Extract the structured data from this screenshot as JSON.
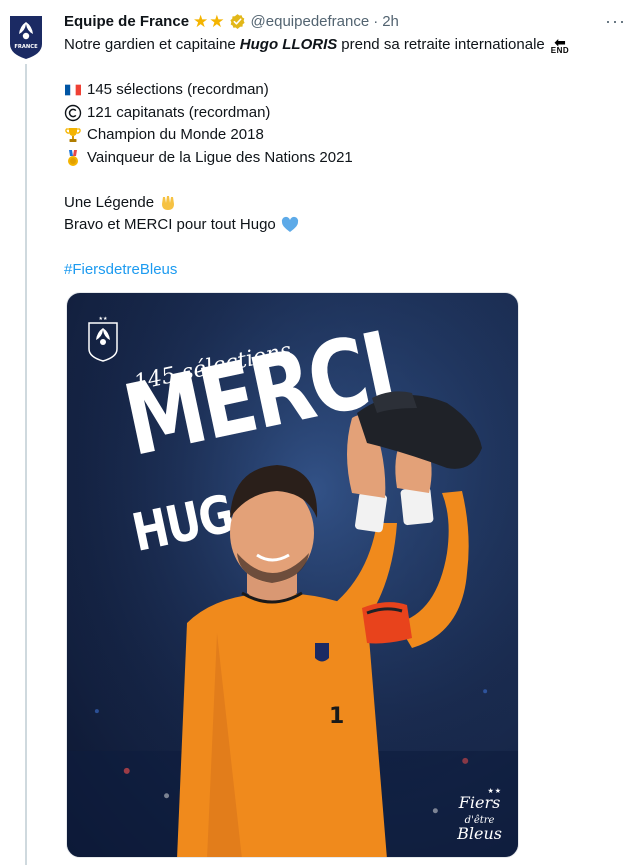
{
  "tweet": {
    "author_name": "Equipe de France",
    "handle": "@equipedefrance",
    "separator": "·",
    "time": "2h",
    "more_label": "···",
    "text_line1_before": "Notre gardien et capitaine",
    "text_line1_emph": "Hugo LLORIS",
    "text_line1_after": "prend sa retraite internationale",
    "end_label": "END",
    "stat_lines": [
      "145 sélections (recordman)",
      "121 capitanats (recordman)",
      "Champion du Monde 2018",
      "Vainqueur de la Ligue des Nations 2021"
    ],
    "legend_line": "Une Légende",
    "bravo_line": "Bravo et MERCI pour tout Hugo",
    "hashtag": "#FiersdetreBleus"
  },
  "avatar": {
    "label": "FRANCE"
  },
  "media": {
    "selections_text": "145 sélections",
    "big_title": "MERCI",
    "sub_title": "HUGO",
    "brand_line1": "Fiers",
    "brand_line2": "d'être",
    "brand_line3": "Bleus",
    "brand_stars": "★★"
  },
  "colors": {
    "link": "#1d9bf0",
    "secondary_text": "#536471",
    "star": "#f4b400",
    "verified": "#e2b719",
    "kit_orange": "#f08a1c"
  }
}
